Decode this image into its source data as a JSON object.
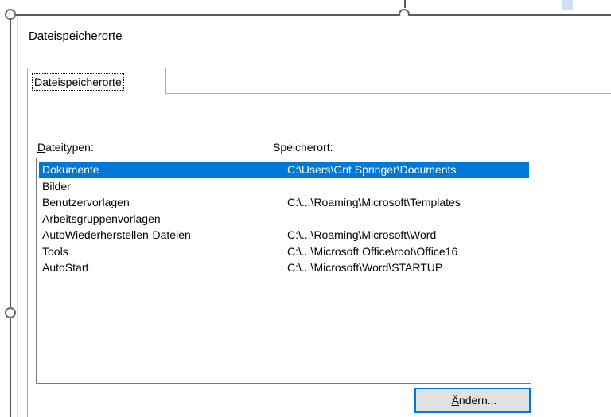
{
  "dialog": {
    "title": "Dateispeicherorte"
  },
  "tabs": [
    {
      "label": "Dateispeicherorte",
      "active": true
    }
  ],
  "columns": {
    "types_label_first": "D",
    "types_label_rest": "ateitypen:",
    "location_label": "Speicherort:"
  },
  "list": {
    "rows": [
      {
        "type": "Dokumente",
        "location": "C:\\Users\\Grit Springer\\Documents",
        "selected": true
      },
      {
        "type": "Bilder",
        "location": "",
        "selected": false
      },
      {
        "type": "Benutzervorlagen",
        "location": "C:\\...\\Roaming\\Microsoft\\Templates",
        "selected": false
      },
      {
        "type": "Arbeitsgruppenvorlagen",
        "location": "",
        "selected": false
      },
      {
        "type": "AutoWiederherstellen-Dateien",
        "location": "C:\\...\\Roaming\\Microsoft\\Word",
        "selected": false
      },
      {
        "type": "Tools",
        "location": "C:\\...\\Microsoft Office\\root\\Office16",
        "selected": false
      },
      {
        "type": "AutoStart",
        "location": "C:\\...\\Microsoft\\Word\\STARTUP",
        "selected": false
      }
    ]
  },
  "buttons": {
    "change_first": "Ä",
    "change_rest": "ndern..."
  },
  "colors": {
    "selection": "#0078d7",
    "button_face": "#e1e1e1",
    "frame_line": "#5a5a5a"
  }
}
